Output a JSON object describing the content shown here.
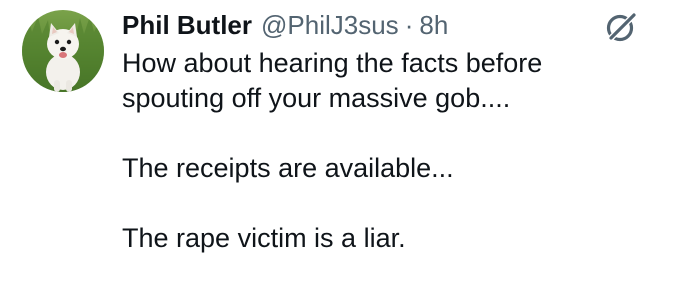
{
  "tweet": {
    "author": {
      "display_name": "Phil Butler",
      "handle": "@PhilJ3sus",
      "avatar_icon": "dog-avatar-icon"
    },
    "separator": "·",
    "timestamp": "8h",
    "grok_icon": "grok-icon",
    "text": {
      "paragraph_1": "How about hearing the facts before\nspouting off your massive gob....",
      "paragraph_2": "The receipts are available...",
      "paragraph_3": "The rape victim is a liar."
    }
  },
  "colors": {
    "text_primary": "#0f1419",
    "text_secondary": "#536471",
    "background": "#ffffff"
  }
}
